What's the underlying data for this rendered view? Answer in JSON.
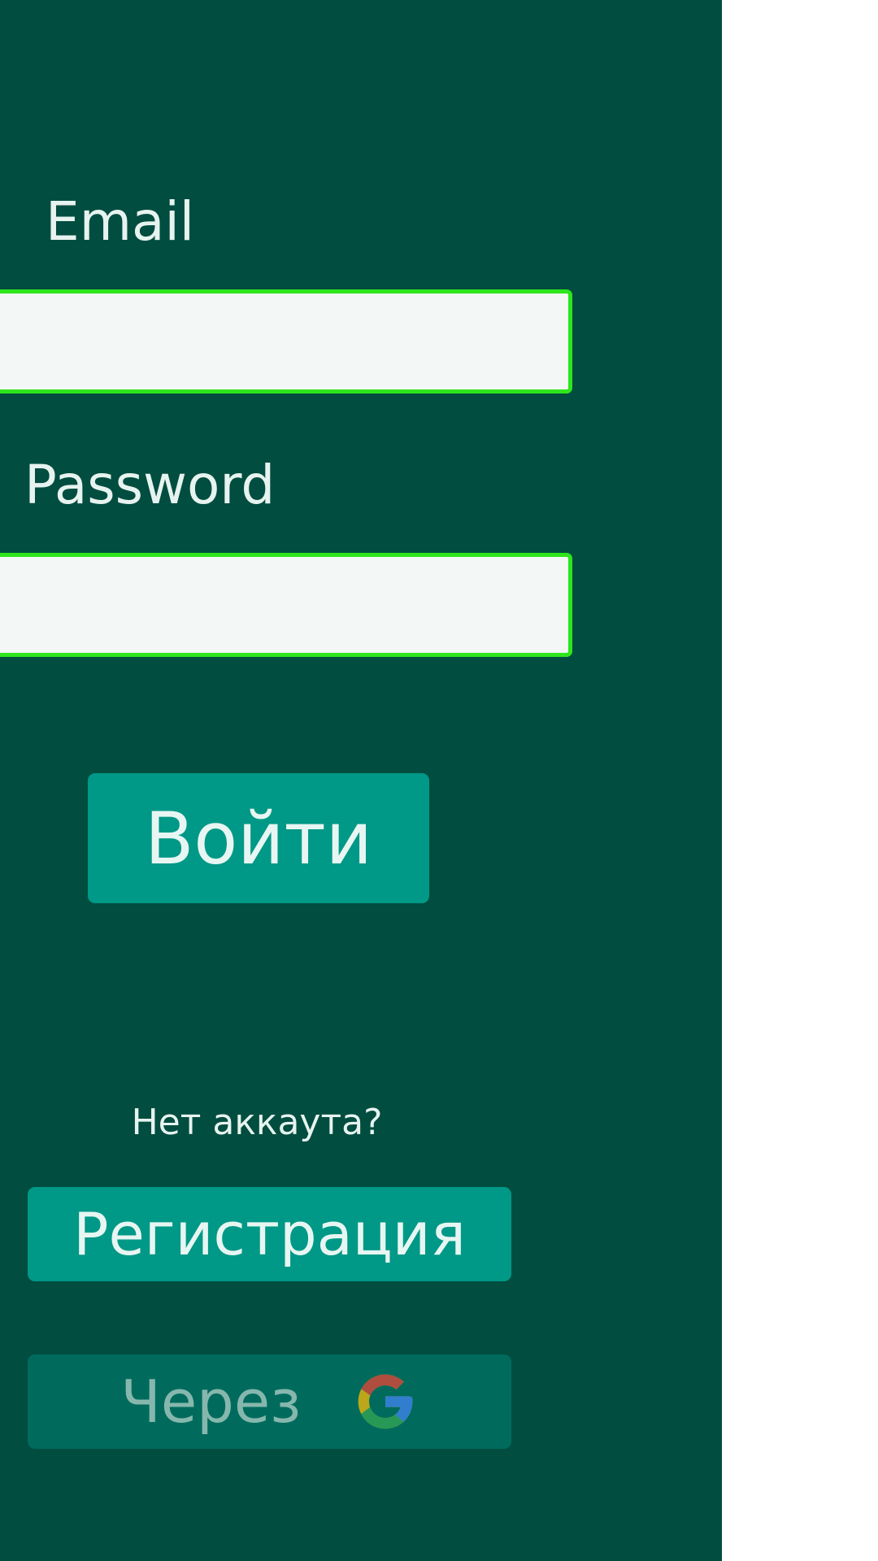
{
  "form": {
    "email_label": "Email",
    "email_value": "",
    "password_label": "Password",
    "password_value": "",
    "login_button": "Войти"
  },
  "signup": {
    "prompt": "Нет аккаута?",
    "register_button": "Регистрация",
    "google_button_text": "Через",
    "google_icon": "google-g-icon"
  },
  "colors": {
    "panel_bg": "#014d40",
    "input_border": "#2ee61b",
    "button_bg": "#009886",
    "google_button_bg": "#006b5d",
    "text": "#e7f3ef"
  }
}
